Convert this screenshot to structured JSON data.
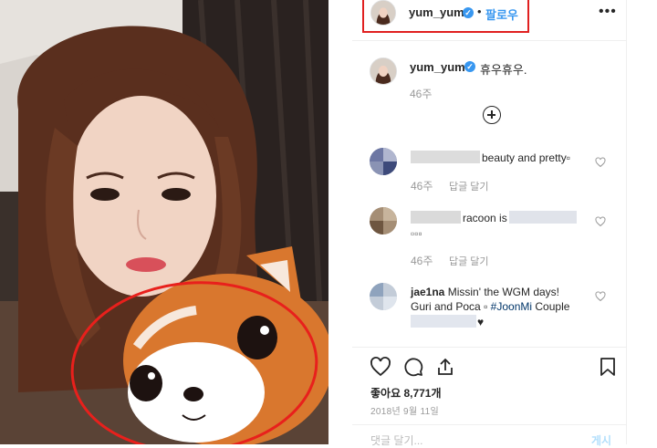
{
  "header": {
    "username": "yum_yum",
    "dot": "•",
    "follow_label": "팔로우",
    "more_label": "•••"
  },
  "caption": {
    "username": "yum_yum",
    "text": "휴우휴우.",
    "time": "46주"
  },
  "comments": [
    {
      "text": "beauty and pretty",
      "trailing": "▫",
      "time": "46주",
      "reply_label": "답글 달기"
    },
    {
      "text": "racoon is",
      "line2": "▫▫▫",
      "time": "46주",
      "reply_label": "답글 달기"
    },
    {
      "username": "jae1na",
      "line1": "Missin' the WGM days!",
      "line2_a": "Guri and Poca",
      "line2_sym": "▫",
      "hashtag": "#JoonMi",
      "line2_b": "Couple",
      "line3_end": "♥"
    }
  ],
  "footer": {
    "likes": "좋아요 8,771개",
    "date": "2018년 9월 11일",
    "add_comment_placeholder": "댓글 달기...",
    "post_label": "게시"
  },
  "colors": {
    "accent": "#3897f0",
    "highlight": "#e02020",
    "muted": "#999999"
  },
  "icons": {
    "verified": "verified-badge-icon",
    "heart": "heart-icon",
    "comment": "comment-icon",
    "share": "share-icon",
    "bookmark": "bookmark-icon",
    "add": "plus-circle-icon",
    "more": "more-options-icon"
  }
}
